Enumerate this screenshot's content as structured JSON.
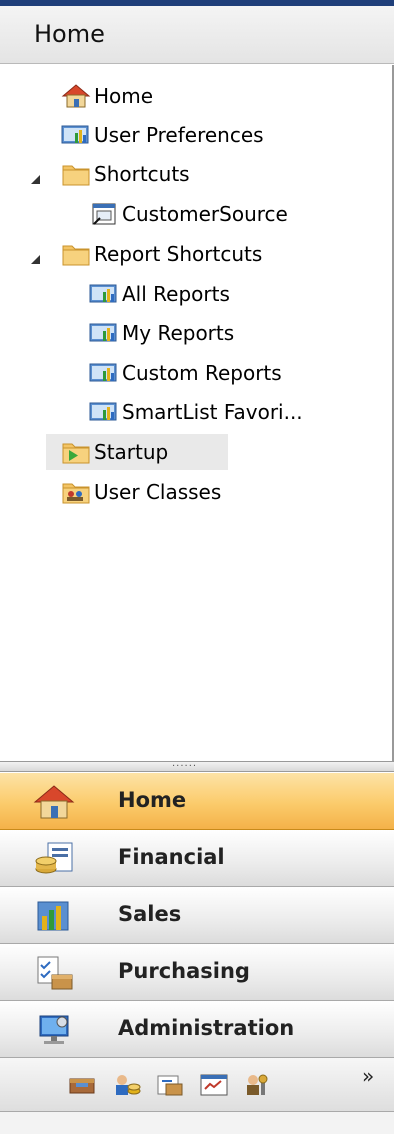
{
  "header": {
    "title": "Home"
  },
  "tree": [
    {
      "label": "Home",
      "icon": "house-icon"
    },
    {
      "label": "User Preferences",
      "icon": "report-icon"
    },
    {
      "label": "Shortcuts",
      "icon": "folder-icon",
      "expanded": true
    },
    {
      "label": "CustomerSource",
      "icon": "shortcut-window-icon"
    },
    {
      "label": "Report Shortcuts",
      "icon": "folder-icon",
      "expanded": true
    },
    {
      "label": "All Reports",
      "icon": "report-icon"
    },
    {
      "label": "My Reports",
      "icon": "report-icon"
    },
    {
      "label": "Custom Reports",
      "icon": "report-icon"
    },
    {
      "label": "SmartList  Favori...",
      "icon": "report-icon"
    },
    {
      "label": "Startup",
      "icon": "startup-folder-icon",
      "selected": true
    },
    {
      "label": "User Classes",
      "icon": "user-classes-folder-icon"
    }
  ],
  "nav": {
    "buttons": [
      {
        "label": "Home",
        "icon": "house-icon",
        "active": true
      },
      {
        "label": "Financial",
        "icon": "financial-icon"
      },
      {
        "label": "Sales",
        "icon": "sales-icon"
      },
      {
        "label": "Purchasing",
        "icon": "purchasing-icon"
      },
      {
        "label": "Administration",
        "icon": "administration-icon"
      }
    ],
    "small_icons": [
      "inventory-icon",
      "hr-payroll-icon",
      "project-icon",
      "manufacturing-icon",
      "field-service-icon"
    ],
    "more": "»"
  },
  "colors": {
    "header_strip": "#1f3f7a",
    "active_nav": "#fbcb6b",
    "selection": "#e9e9e9"
  }
}
